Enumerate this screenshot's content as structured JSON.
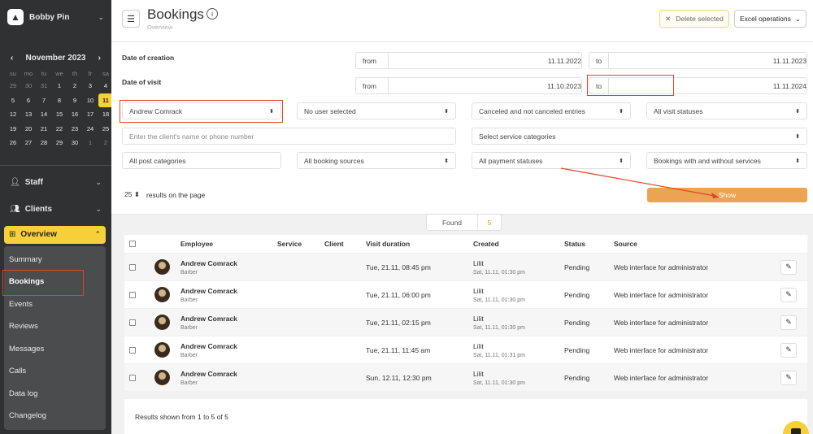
{
  "sidebar": {
    "brand": "Bobby Pin",
    "calendar": {
      "month": "November 2023",
      "weekdays": [
        "su",
        "mo",
        "tu",
        "we",
        "th",
        "fr",
        "sa"
      ],
      "weeks": [
        [
          "29",
          "30",
          "31",
          "1",
          "2",
          "3",
          "4"
        ],
        [
          "5",
          "6",
          "7",
          "8",
          "9",
          "10",
          "11"
        ],
        [
          "12",
          "13",
          "14",
          "15",
          "16",
          "17",
          "18"
        ],
        [
          "19",
          "20",
          "21",
          "22",
          "23",
          "24",
          "25"
        ],
        [
          "26",
          "27",
          "28",
          "29",
          "30",
          "1",
          "2"
        ]
      ],
      "today": "11"
    },
    "nav": {
      "staff": "Staff",
      "clients": "Clients",
      "overview": "Overview",
      "sub": [
        "Summary",
        "Bookings",
        "Events",
        "Reviews",
        "Messages",
        "Calls",
        "Data log",
        "Changelog"
      ]
    }
  },
  "header": {
    "title": "Bookings",
    "breadcrumb": "Overview",
    "delete_selected": "Delete selected",
    "excel_operations": "Excel operations"
  },
  "filters": {
    "date_of_creation_label": "Date of creation",
    "date_of_visit_label": "Date of visit",
    "from_label": "from",
    "to_label": "to",
    "creation_from": "11.11.2022",
    "creation_to": "11.11.2023",
    "visit_from": "11.10.2023",
    "visit_to": "11.11.2024",
    "employee": "Andrew Comrack",
    "user": "No user selected",
    "entries": "Canceled and not canceled entries",
    "visit_statuses": "All visit statuses",
    "client_placeholder": "Enter the client's name or phone number",
    "service_categories": "Select service categories",
    "post_categories": "All post categories",
    "booking_sources": "All booking sources",
    "payment_statuses": "All payment statuses",
    "services_filter": "Bookings with and without services",
    "per_page_value": "25",
    "per_page_label": "results on the page",
    "show_button": "Show"
  },
  "results": {
    "found_label": "Found",
    "found_count": "5",
    "columns": [
      "Employee",
      "Service",
      "Client",
      "Visit duration",
      "Created",
      "Status",
      "Source"
    ],
    "rows": [
      {
        "employee": "Andrew Comrack",
        "role": "Barber",
        "visit": "Tue, 21.11, 08:45 pm",
        "created_by": "Lilit",
        "created_at": "Sat, 11.11, 01:30 pm",
        "status": "Pending",
        "source": "Web interface for administrator"
      },
      {
        "employee": "Andrew Comrack",
        "role": "Barber",
        "visit": "Tue, 21.11, 06:00 pm",
        "created_by": "Lilit",
        "created_at": "Sat, 11.11, 01:30 pm",
        "status": "Pending",
        "source": "Web interface for administrator"
      },
      {
        "employee": "Andrew Comrack",
        "role": "Barber",
        "visit": "Tue, 21.11, 02:15 pm",
        "created_by": "Lilit",
        "created_at": "Sat, 11.11, 01:30 pm",
        "status": "Pending",
        "source": "Web interface for administrator"
      },
      {
        "employee": "Andrew Comrack",
        "role": "Barber",
        "visit": "Tue, 21.11, 11:45 am",
        "created_by": "Lilit",
        "created_at": "Sat, 11.11, 01:31 pm",
        "status": "Pending",
        "source": "Web interface for administrator"
      },
      {
        "employee": "Andrew Comrack",
        "role": "Barber",
        "visit": "Sun, 12.11, 12:30 pm",
        "created_by": "Lilit",
        "created_at": "Sat, 11.11, 01:30 pm",
        "status": "Pending",
        "source": "Web interface for administrator"
      }
    ],
    "footer": "Results shown from 1 to 5 of 5"
  },
  "colors": {
    "accent": "#f5d03b",
    "show_button": "#eba452",
    "sidebar_bg": "#2f3133",
    "annotation": "#e0452b"
  }
}
